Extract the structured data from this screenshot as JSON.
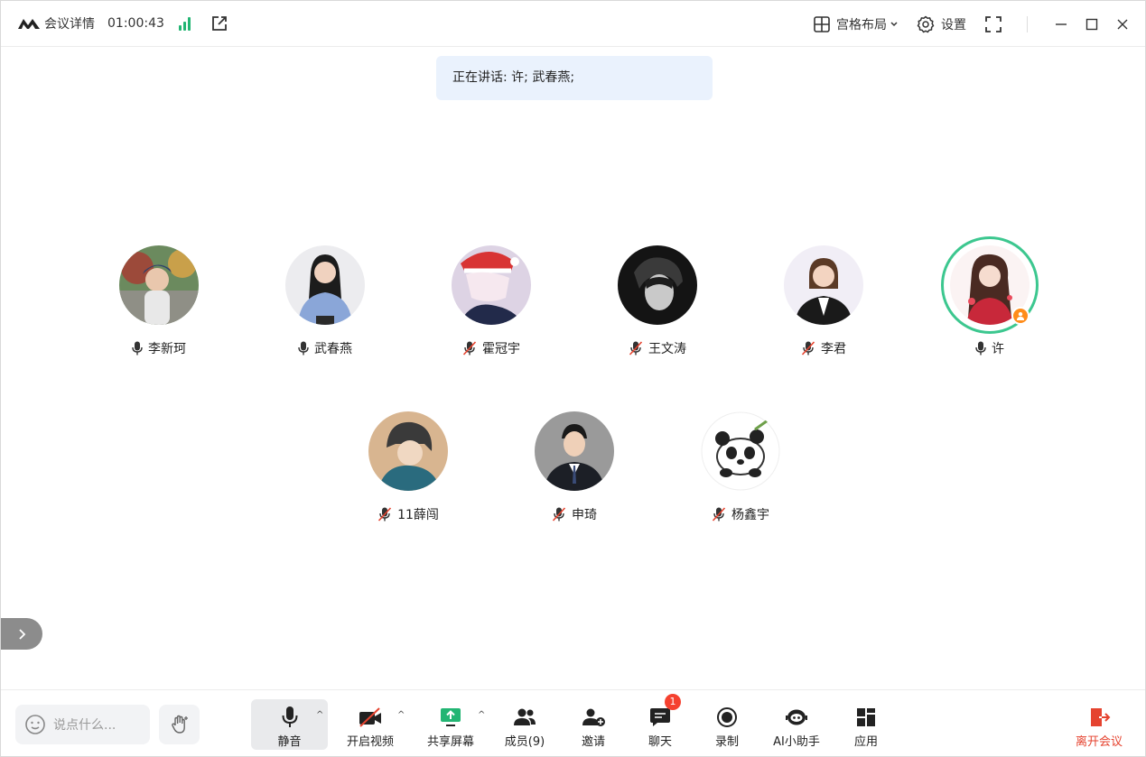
{
  "header": {
    "title": "会议详情",
    "timer": "01:00:43",
    "layout_label": "宫格布局",
    "settings_label": "设置"
  },
  "speaking": {
    "text": "正在讲话: 许; 武春燕;"
  },
  "participants": [
    {
      "name": "李新珂",
      "mic": "on"
    },
    {
      "name": "武春燕",
      "mic": "on"
    },
    {
      "name": "霍冠宇",
      "mic": "off"
    },
    {
      "name": "王文涛",
      "mic": "off"
    },
    {
      "name": "李君",
      "mic": "off"
    },
    {
      "name": "许",
      "mic": "on",
      "host": true
    },
    {
      "name": "11薛闯",
      "mic": "off"
    },
    {
      "name": "申琦",
      "mic": "off"
    },
    {
      "name": "杨鑫宇",
      "mic": "off"
    }
  ],
  "toolbar": {
    "chat_placeholder": "说点什么...",
    "mute_label": "静音",
    "video_label": "开启视频",
    "share_label": "共享屏幕",
    "members_label": "成员(9)",
    "invite_label": "邀请",
    "chat_label": "聊天",
    "chat_badge": "1",
    "record_label": "录制",
    "ai_label": "AI小助手",
    "apps_label": "应用",
    "leave_label": "离开会议"
  },
  "colors": {
    "accent_green": "#22b573",
    "host_ring": "#3cc78f",
    "leave_red": "#e5432f",
    "banner_bg": "#eaf2fd",
    "badge_red": "#f5412f"
  }
}
